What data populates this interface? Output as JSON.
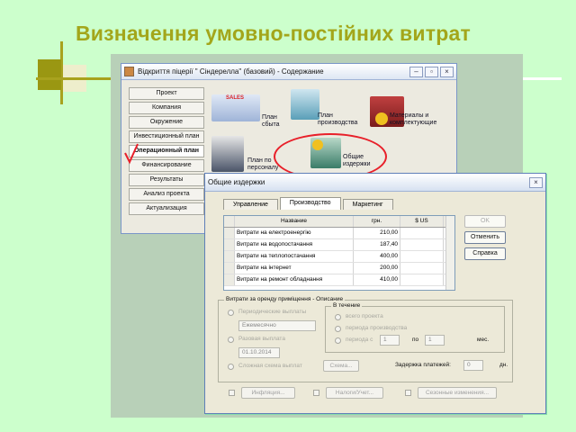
{
  "slide": {
    "title": "Визначення умовно-постійних витрат"
  },
  "window": {
    "title": "Відкриття піцерії \" Сіндерелла\" (базовий) - Содержание",
    "nav": [
      "Проект",
      "Компания",
      "Окружение",
      "Инвестиционный план",
      "Операционный план",
      "Финансирование",
      "Результаты",
      "Анализ проекта",
      "Актуализация"
    ],
    "active_nav": 4,
    "modules": {
      "sales_plan": "План сбыта",
      "production_plan": "План производства",
      "materials": "Материалы и комплектующие",
      "staff_plan": "План по персоналу",
      "overheads": "Общие издержки"
    },
    "sales_badge": "SALES"
  },
  "dialog": {
    "title": "Общие издержки",
    "tabs": [
      "Управление",
      "Производство",
      "Маркетинг"
    ],
    "active_tab": 1,
    "columns": [
      "Название",
      "грн.",
      "$ US"
    ],
    "rows": [
      {
        "name": "Витрати на електроенергію",
        "uah": "210,00",
        "usd": ""
      },
      {
        "name": "Витрати на водопостачання",
        "uah": "187,40",
        "usd": ""
      },
      {
        "name": "Витрати на теплопостачання",
        "uah": "400,00",
        "usd": ""
      },
      {
        "name": "Витрати на інтернет",
        "uah": "200,00",
        "usd": ""
      },
      {
        "name": "Витрати на ремонт обладнання",
        "uah": "410,00",
        "usd": ""
      }
    ],
    "buttons": {
      "ok": "OK",
      "cancel": "Отменить",
      "help": "Справка"
    },
    "description_group": "Витрати за оренду приміщення - Описание",
    "periodic": "Периодические выплаты",
    "period_value": "Ежемесячно",
    "one_time": "Разовая выплата",
    "date_value": "01.10.2014",
    "complex": "Сложная схема выплат",
    "scheme_btn": "Схема...",
    "during_group": "В течение",
    "whole_project": "всего проекта",
    "production_period": "периода производства",
    "period_from": "периода с",
    "from_value": "1",
    "to_label": "по",
    "to_value": "1",
    "months": "мес.",
    "delay_label": "Задержка платежей:",
    "delay_value": "0",
    "days": "дн.",
    "inflation_btn": "Инфляция...",
    "taxes_btn": "Налоги/Учет...",
    "seasonal_btn": "Сезонные изменения..."
  }
}
